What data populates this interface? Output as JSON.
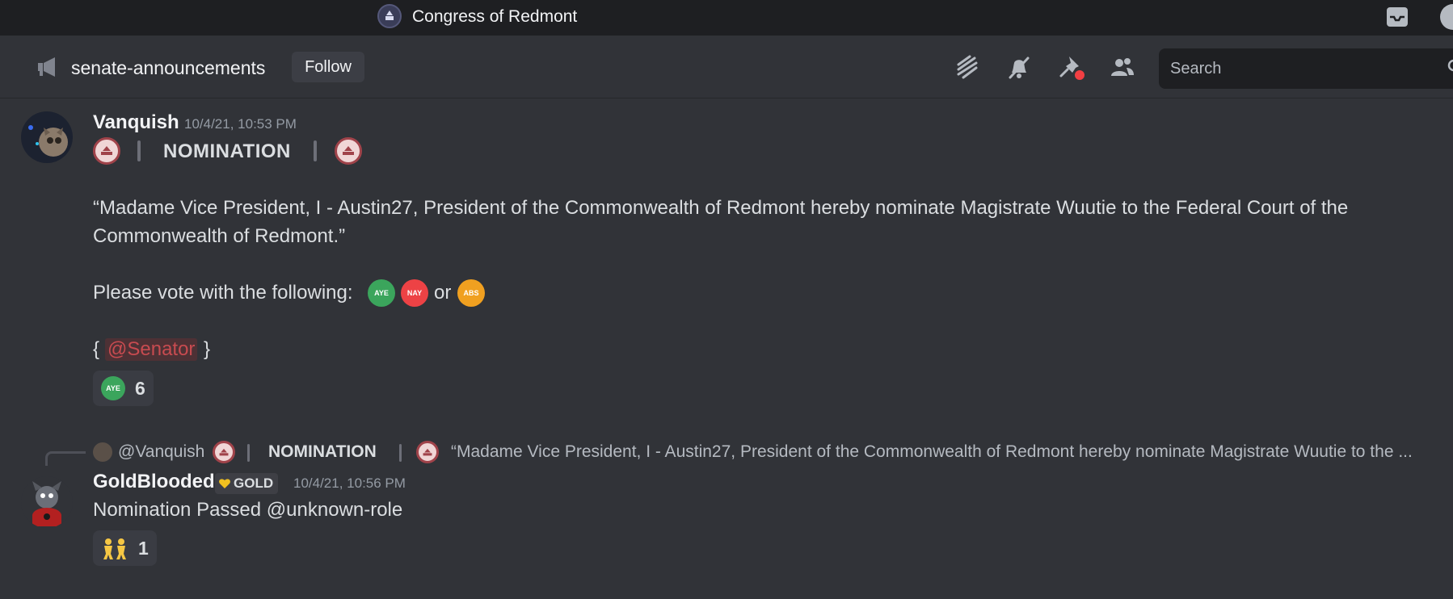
{
  "window": {
    "server_name": "Congress of Redmont"
  },
  "channel": {
    "name": "senate-announcements",
    "follow_label": "Follow",
    "search_placeholder": "Search"
  },
  "messages": [
    {
      "author": "Vanquish",
      "timestamp": "10/4/21, 10:53 PM",
      "title": "NOMINATION",
      "quote_line1": "“Madame Vice President, I - Austin27, President of the Commonwealth of Redmont hereby nominate Magistrate Wuutie to the Federal Court of the",
      "quote_line2": "Commonwealth of Redmont.”",
      "vote_prompt": "Please vote with the following:",
      "vote_or": "or",
      "vote_aye": "AYE",
      "vote_nay": "NAY",
      "vote_abs": "ABS",
      "mention_open": "{",
      "mention": "@Senator",
      "mention_close": "}",
      "reaction_count": "6"
    },
    {
      "reply_author": "@Vanquish",
      "reply_title": "NOMINATION",
      "reply_preview": "“Madame Vice President, I - Austin27, President of the Commonwealth of Redmont hereby nominate Magistrate Wuutie to the ...",
      "author": "GoldBlooded",
      "tag": "GOLD",
      "timestamp": "10/4/21, 10:56 PM",
      "text": "Nomination Passed @unknown-role",
      "reaction_count": "1"
    }
  ],
  "colors": {
    "background": "#313338",
    "aye": "#3ba55c",
    "nay": "#ed4245",
    "abs": "#f0a020",
    "mention": "#c84b50"
  }
}
